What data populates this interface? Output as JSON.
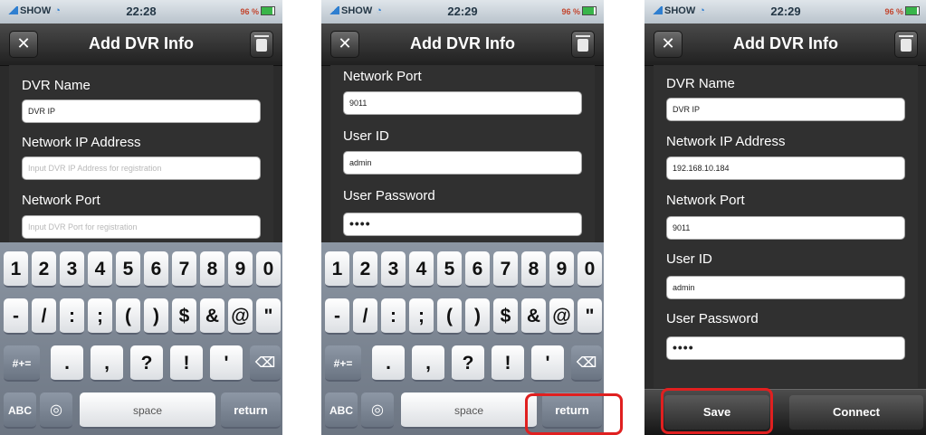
{
  "status": {
    "carrier": "SHOW",
    "battery_pct": "96 %"
  },
  "screens": [
    {
      "time": "22:28",
      "title": "Add DVR Info",
      "close_glyph": "✕",
      "fields": [
        {
          "label": "DVR Name",
          "value": "DVR IP",
          "kind": "value"
        },
        {
          "label": "Network IP Address",
          "value": "Input DVR IP Address for registration",
          "kind": "placeholder"
        },
        {
          "label": "Network Port",
          "value": "Input DVR Port for registration",
          "kind": "placeholder"
        }
      ],
      "keyboard": {
        "row1": [
          "1",
          "2",
          "3",
          "4",
          "5",
          "6",
          "7",
          "8",
          "9",
          "0"
        ],
        "row2": [
          "-",
          "/",
          ":",
          ";",
          "(",
          ")",
          "$",
          "&",
          "@",
          "\""
        ],
        "row3_left": "#+=",
        "row3": [
          ".",
          ",",
          "?",
          "!",
          "'"
        ],
        "delete_icon": "backspace-icon",
        "abc": "ABC",
        "globe_icon": "globe-icon",
        "space": "space",
        "return": "return"
      }
    },
    {
      "time": "22:29",
      "title": "Add DVR Info",
      "close_glyph": "✕",
      "fields": [
        {
          "label": "Network Port",
          "value": "9011",
          "kind": "value"
        },
        {
          "label": "User ID",
          "value": "admin",
          "kind": "value"
        },
        {
          "label": "User Password",
          "value": "••••",
          "kind": "secret"
        }
      ],
      "keyboard": {
        "row1": [
          "1",
          "2",
          "3",
          "4",
          "5",
          "6",
          "7",
          "8",
          "9",
          "0"
        ],
        "row2": [
          "-",
          "/",
          ":",
          ";",
          "(",
          ")",
          "$",
          "&",
          "@",
          "\""
        ],
        "row3_left": "#+=",
        "row3": [
          ".",
          ",",
          "?",
          "!",
          "'"
        ],
        "delete_icon": "backspace-icon",
        "abc": "ABC",
        "globe_icon": "globe-icon",
        "space": "space",
        "return": "return"
      }
    },
    {
      "time": "22:29",
      "title": "Add DVR Info",
      "close_glyph": "✕",
      "fields": [
        {
          "label": "DVR Name",
          "value": "DVR IP",
          "kind": "value"
        },
        {
          "label": "Network IP Address",
          "value": "192.168.10.184",
          "kind": "value"
        },
        {
          "label": "Network Port",
          "value": "9011",
          "kind": "value"
        },
        {
          "label": "User ID",
          "value": "admin",
          "kind": "value"
        },
        {
          "label": "User Password",
          "value": "••••",
          "kind": "secret"
        }
      ],
      "actions": {
        "save": "Save",
        "connect": "Connect"
      }
    }
  ],
  "colors": {
    "highlight": "#e02020",
    "keyboard": "#7b8591",
    "form_bg": "#303030"
  }
}
